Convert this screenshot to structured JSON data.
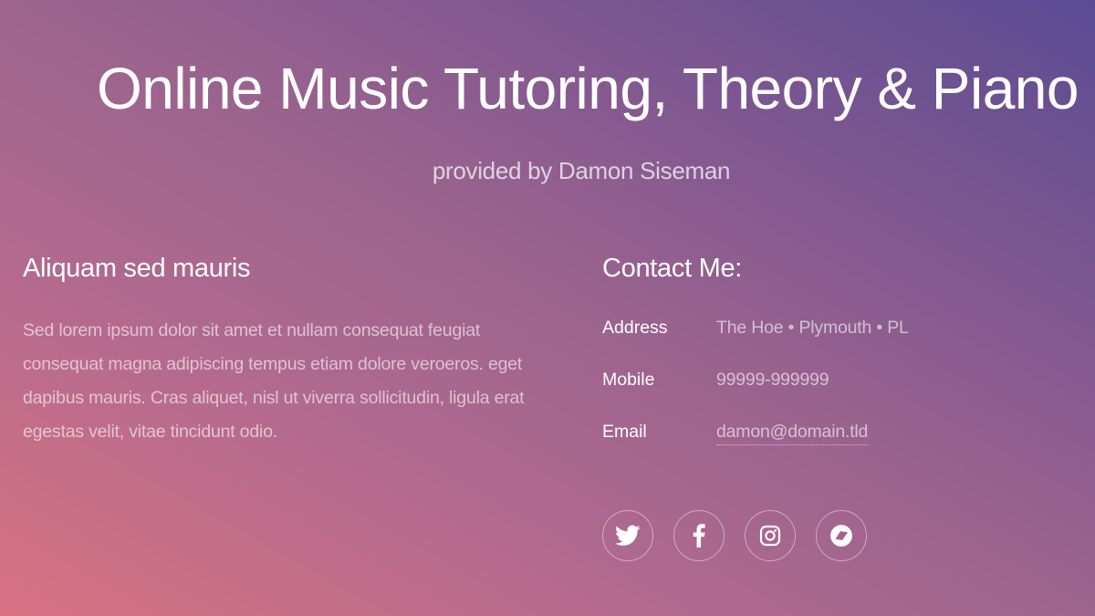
{
  "header": {
    "title": "Online Music Tutoring, Theory & Piano",
    "subtitle": "provided by Damon Siseman"
  },
  "intro": {
    "heading": "Aliquam sed mauris",
    "text": "Sed lorem ipsum dolor sit amet et nullam consequat feugiat consequat magna adipiscing tempus etiam dolore veroeros. eget dapibus mauris. Cras aliquet, nisl ut viverra sollicitudin, ligula erat egestas velit, vitae tincidunt odio."
  },
  "contact": {
    "heading": "Contact Me:",
    "address_label": "Address",
    "address_value": "The Hoe • Plymouth • PL",
    "mobile_label": "Mobile",
    "mobile_value": "99999-999999",
    "email_label": "Email",
    "email_value": "damon@domain.tld"
  },
  "social": [
    {
      "icon": "twitter-icon"
    },
    {
      "icon": "facebook-icon"
    },
    {
      "icon": "instagram-icon"
    },
    {
      "icon": "dribbble-icon"
    }
  ],
  "colors": {
    "gradient_start": "#d87282",
    "gradient_end": "#5a4c94",
    "text": "#ffffff"
  }
}
